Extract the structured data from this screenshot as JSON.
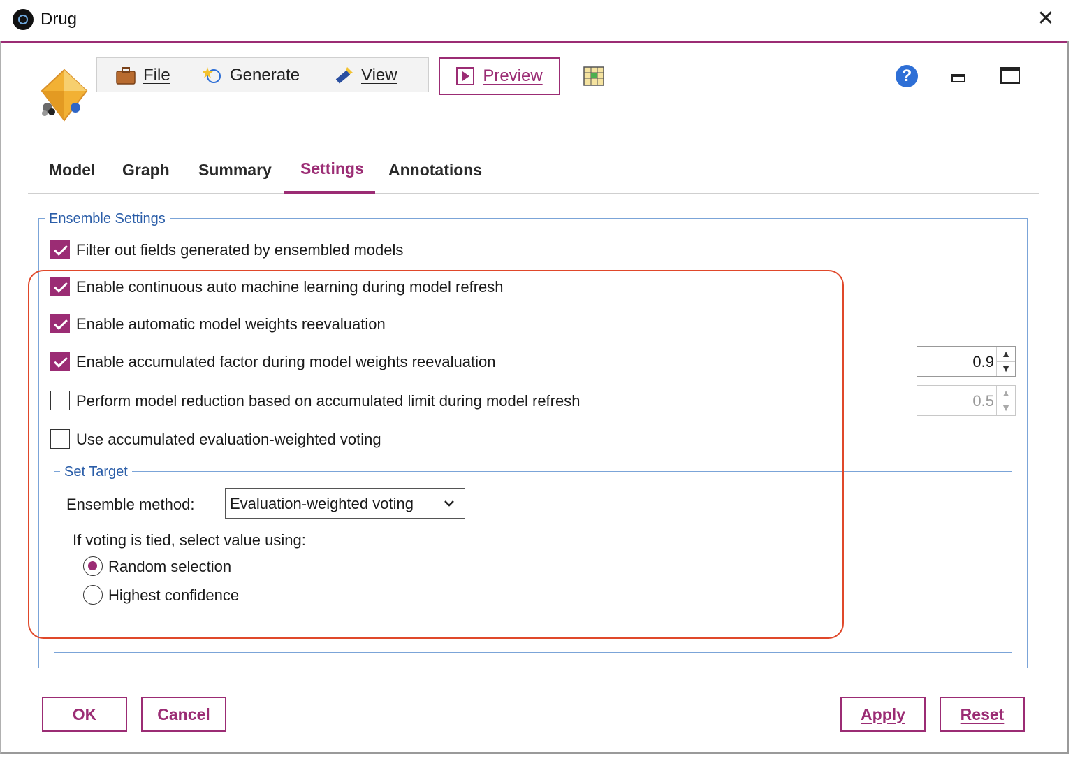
{
  "window": {
    "title": "Drug",
    "close": "✕"
  },
  "toolbar": {
    "file_label": "File",
    "generate_label": "Generate",
    "view_label": "View",
    "preview_label": "Preview",
    "help_glyph": "?"
  },
  "tabs": [
    {
      "label": "Model"
    },
    {
      "label": "Graph"
    },
    {
      "label": "Summary"
    },
    {
      "label": "Settings",
      "active": true
    },
    {
      "label": "Annotations"
    }
  ],
  "ensemble_settings": {
    "legend": "Ensemble Settings",
    "options": [
      {
        "label": "Filter out fields generated by ensembled models",
        "checked": true
      },
      {
        "label": "Enable continuous auto machine learning during model refresh",
        "checked": true
      },
      {
        "label": "Enable automatic model weights reevaluation",
        "checked": true
      },
      {
        "label": "Enable accumulated factor during model weights reevaluation",
        "checked": true
      },
      {
        "label": "Perform model reduction based on accumulated limit during model refresh",
        "checked": false
      },
      {
        "label": "Use accumulated evaluation-weighted voting",
        "checked": false
      }
    ],
    "accumulated_factor_value": "0.9",
    "accumulated_limit_value": "0.5"
  },
  "set_target": {
    "legend": "Set Target",
    "ensemble_method_label": "Ensemble method:",
    "ensemble_method_value": "Evaluation-weighted voting",
    "tie_label": "If voting is tied, select value using:",
    "tie_options": [
      {
        "label": "Random selection",
        "selected": true
      },
      {
        "label": "Highest confidence",
        "selected": false
      }
    ]
  },
  "buttons": {
    "ok": "OK",
    "cancel": "Cancel",
    "apply": "Apply",
    "reset": "Reset"
  },
  "colors": {
    "accent": "#9b2c74",
    "group_border": "#7ba4d8",
    "highlight": "#e0482a",
    "help": "#2e6fd6"
  }
}
